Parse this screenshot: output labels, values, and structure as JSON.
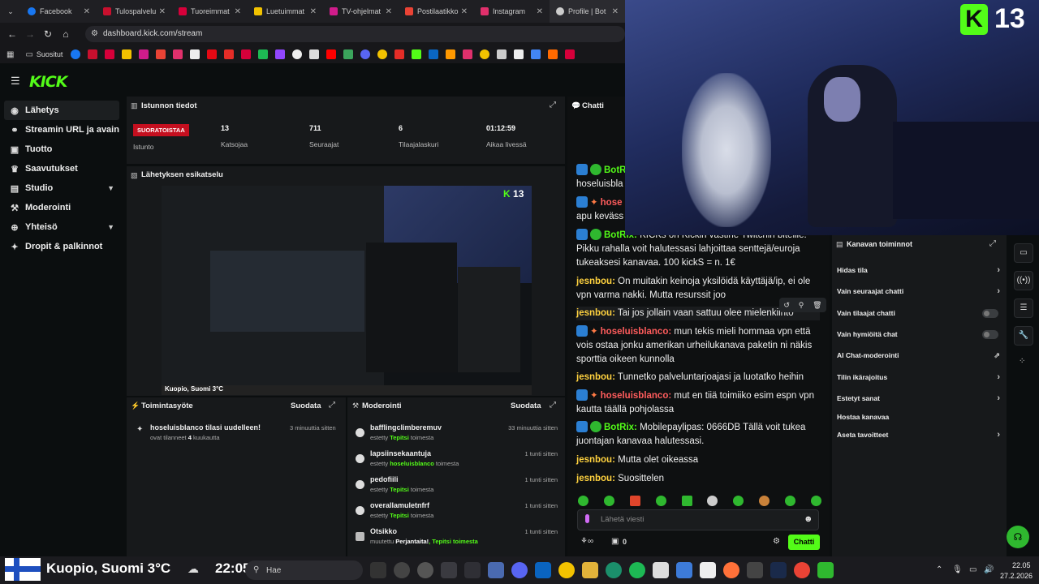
{
  "browser": {
    "tabs": [
      {
        "label": "Facebook",
        "color": "#1877f2"
      },
      {
        "label": "Tulospalvelu",
        "color": "#c8102e"
      },
      {
        "label": "Tuoreimmat",
        "color": "#d6003a"
      },
      {
        "label": "Luetuimmat",
        "color": "#f2c200"
      },
      {
        "label": "TV-ohjelmat",
        "color": "#d01c8b"
      },
      {
        "label": "Postilaatikko",
        "color": "#ea4335"
      },
      {
        "label": "Instagram",
        "color": "#e1306c"
      },
      {
        "label": "Profile | Bot",
        "color": "#cccccc"
      }
    ],
    "url": "dashboard.kick.com/stream",
    "bookmarks_label": "Suositut"
  },
  "sidebar": {
    "logo": "KICK",
    "items": [
      {
        "label": "Lähetys",
        "icon": "broadcast-icon"
      },
      {
        "label": "Streamin URL ja avain",
        "icon": "link-icon"
      },
      {
        "label": "Tuotto",
        "icon": "money-icon"
      },
      {
        "label": "Saavutukset",
        "icon": "trophy-icon"
      },
      {
        "label": "Studio",
        "icon": "studio-icon"
      },
      {
        "label": "Moderointi",
        "icon": "gavel-icon"
      },
      {
        "label": "Yhteisö",
        "icon": "community-icon"
      },
      {
        "label": "Dropit & palkinnot",
        "icon": "drops-icon"
      }
    ]
  },
  "session": {
    "title": "Istunnon tiedot",
    "status": "SUORATOISTAA",
    "status_label": "Istunto",
    "stats": [
      {
        "value": "13",
        "label": "Katsojaa"
      },
      {
        "value": "711",
        "label": "Seuraajat"
      },
      {
        "value": "6",
        "label": "Tilaajalaskuri"
      },
      {
        "value": "01:12:59",
        "label": "Aikaa livessä"
      }
    ]
  },
  "preview": {
    "title": "Lähetyksen esikatselu",
    "viewer_count": "13",
    "weather_caption": "Kuopio, Suomi 3°C"
  },
  "activity": {
    "title": "Toimintasyöte",
    "filter": "Suodata",
    "items": [
      {
        "name": "hoseluisblanco",
        "action": "tilasi uudelleen!",
        "sub_prefix": "ovat tilanneet",
        "count": "4",
        "sub_suffix": "kuukautta",
        "time": "3 minuuttia sitten"
      }
    ]
  },
  "moderation": {
    "title": "Moderointi",
    "filter": "Suodata",
    "items": [
      {
        "name": "bafflingclimberemuv",
        "prefix": "estetty",
        "by": "Tepitsi",
        "suffix": "toimesta",
        "time": "33 minuuttia sitten"
      },
      {
        "name": "lapsiinsekaantuja",
        "prefix": "estetty",
        "by": "hoseluisblanco",
        "suffix": "toimesta",
        "time": "1 tunti sitten"
      },
      {
        "name": "pedofiili",
        "prefix": "estetty",
        "by": "Tepitsi",
        "suffix": "toimesta",
        "time": "1 tunti sitten"
      },
      {
        "name": "overallamuletnfrf",
        "prefix": "estetty",
        "by": "Tepitsi",
        "suffix": "toimesta",
        "time": "1 tunti sitten"
      },
      {
        "name": "Otsikko",
        "prefix": "muutettu",
        "by": "Perjantaita!",
        "suffix": ", Tepitsi toimesta",
        "time": "1 tunti sitten"
      }
    ]
  },
  "chat": {
    "title": "Chatti",
    "messages": [
      {
        "user": "BotRi",
        "text": "hoseluisbla",
        "color": "#53fc18"
      },
      {
        "user": "hose",
        "text": "apu keväss",
        "color": "#ff5c5c"
      },
      {
        "user": "BotRix:",
        "text": "KICKs on Kickin vastine Twitchin biteille. Pikku rahalla voit halutessasi lahjoittaa senttejä/euroja tukeaksesi kanavaa. 100 kickS = n. 1€",
        "color": "#53fc18"
      },
      {
        "user": "jesnbou:",
        "text": "On muitakin keinoja yksilöidä käyttäjä/ip, ei ole vpn varma nakki. Mutta resurssit joo",
        "color": "#ffd23f"
      },
      {
        "user": "jesnbou:",
        "text": "Tai jos jollain vaan sattuu olee mielenkiinto",
        "color": "#ffd23f"
      },
      {
        "user": "hoseluisblanco:",
        "text": "mun tekis mieli hommaa vpn että vois ostaa jonku amerikan urheilukanava paketin ni näkis sporttia oikeen kunnolla",
        "color": "#ff5c5c"
      },
      {
        "user": "jesnbou:",
        "text": "Tunnetko palveluntarjoajasi ja luotatko heihin",
        "color": "#ffd23f"
      },
      {
        "user": "hoseluisblanco:",
        "text": "mut en tiiä toimiiko esim espn vpn kautta täällä pohjolassa",
        "color": "#ff5c5c"
      },
      {
        "user": "BotRix:",
        "text": "Mobilepaylipas: 0666DB Tällä voit tukea juontajan kanavaa halutessasi.",
        "color": "#53fc18"
      },
      {
        "user": "jesnbou:",
        "text": "Mutta olet oikeassa",
        "color": "#ffd23f"
      },
      {
        "user": "jesnbou:",
        "text": "Suosittelen",
        "color": "#ffd23f"
      }
    ],
    "input_placeholder": "Lähetä viesti",
    "points": "0",
    "send_label": "Chatti"
  },
  "channel_actions": {
    "title": "Kanavan toiminnot",
    "items": [
      {
        "label": "Hidas tila",
        "kind": "arrow"
      },
      {
        "label": "Vain seuraajat chatti",
        "kind": "arrow"
      },
      {
        "label": "Vain tilaajat chatti",
        "kind": "toggle"
      },
      {
        "label": "Vain hymiöitä chat",
        "kind": "toggle"
      },
      {
        "label": "AI Chat-moderointi",
        "kind": "external"
      },
      {
        "label": "Tilin ikärajoitus",
        "kind": "arrow"
      },
      {
        "label": "Estetyt sanat",
        "kind": "arrow"
      },
      {
        "label": "Hostaa kanavaa",
        "kind": "none"
      },
      {
        "label": "Aseta tavoitteet",
        "kind": "arrow"
      }
    ]
  },
  "webcam": {
    "viewer_count": "13"
  },
  "taskbar": {
    "weather": "Kuopio, Suomi 3°C",
    "clock_overlay": "22:05",
    "search": "Hae",
    "time": "22.05",
    "date": "27.2.2026"
  }
}
